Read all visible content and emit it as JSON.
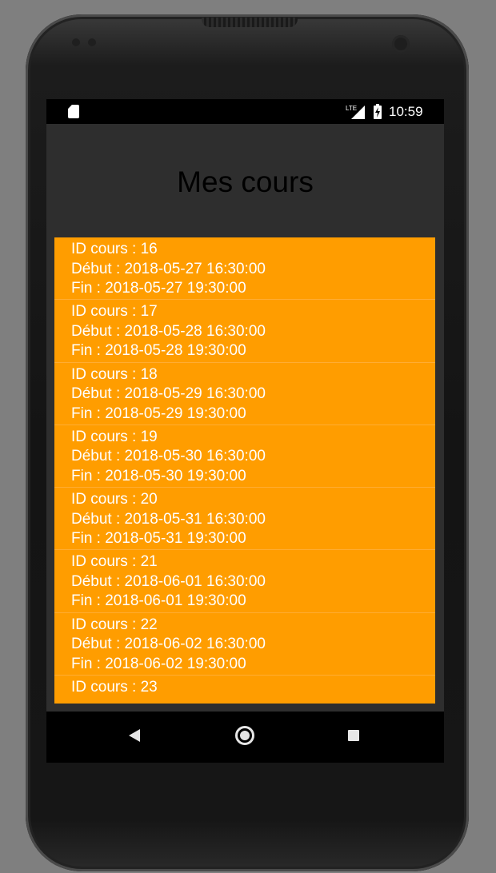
{
  "status_bar": {
    "time": "10:59",
    "network": "LTE",
    "icons": [
      "sd-card-icon",
      "lte-signal-icon",
      "battery-charging-icon"
    ]
  },
  "screen": {
    "title": "Mes cours"
  },
  "courses": [
    {
      "id_line": "ID cours : 16",
      "start_line": "Début : 2018-05-27 16:30:00",
      "end_line": "Fin : 2018-05-27 19:30:00"
    },
    {
      "id_line": "ID cours : 17",
      "start_line": "Début : 2018-05-28 16:30:00",
      "end_line": "Fin : 2018-05-28 19:30:00"
    },
    {
      "id_line": "ID cours : 18",
      "start_line": "Début : 2018-05-29 16:30:00",
      "end_line": "Fin : 2018-05-29 19:30:00"
    },
    {
      "id_line": "ID cours : 19",
      "start_line": "Début : 2018-05-30 16:30:00",
      "end_line": "Fin : 2018-05-30 19:30:00"
    },
    {
      "id_line": "ID cours : 20",
      "start_line": "Début : 2018-05-31 16:30:00",
      "end_line": "Fin : 2018-05-31 19:30:00"
    },
    {
      "id_line": "ID cours : 21",
      "start_line": "Début : 2018-06-01 16:30:00",
      "end_line": "Fin : 2018-06-01 19:30:00"
    },
    {
      "id_line": "ID cours : 22",
      "start_line": "Début : 2018-06-02 16:30:00",
      "end_line": "Fin : 2018-06-02 19:30:00"
    },
    {
      "id_line": "ID cours : 23"
    }
  ],
  "nav_bar": {
    "icons": [
      "back-icon",
      "home-icon",
      "recent-apps-icon"
    ]
  },
  "colors": {
    "list_background": "#ff9d00",
    "app_background": "#2e2e2e",
    "title_text": "#000000",
    "item_text": "#ffffff"
  }
}
